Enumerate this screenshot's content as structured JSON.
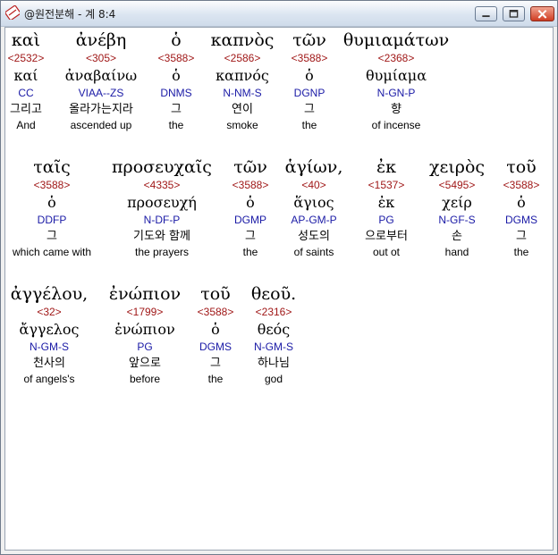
{
  "window": {
    "title": "@원전분해 - 계 8:4",
    "icon": "app-book-icon",
    "buttons": [
      "minimize-icon",
      "maximize-icon",
      "close-icon"
    ],
    "colors": {
      "strong": "#a01818",
      "parse": "#1a1aa6",
      "text": "#000000"
    }
  },
  "verse": {
    "rows": [
      [
        {
          "greek": "καὶ",
          "strong": "<2532>",
          "lemma": "καί",
          "parse": "CC",
          "korean": "그리고",
          "english": "And"
        },
        {
          "greek": "ἀνέβη",
          "strong": "<305>",
          "lemma": "ἀναβαίνω",
          "parse": "VIAA--ZS",
          "korean": "올라가는지라",
          "english": "ascended up"
        },
        {
          "greek": "ὁ",
          "strong": "<3588>",
          "lemma": "ὁ",
          "parse": "DNMS",
          "korean": "그",
          "english": "the"
        },
        {
          "greek": "καπνὸς",
          "strong": "<2586>",
          "lemma": "καπνός",
          "parse": "N-NM-S",
          "korean": "연이",
          "english": "smoke"
        },
        {
          "greek": "τῶν",
          "strong": "<3588>",
          "lemma": "ὁ",
          "parse": "DGNP",
          "korean": "그",
          "english": "the"
        },
        {
          "greek": "θυμιαμάτων",
          "strong": "<2368>",
          "lemma": "θυμίαμα",
          "parse": "N-GN-P",
          "korean": "향",
          "english": "of incense"
        }
      ],
      [
        {
          "greek": "ταῖς",
          "strong": "<3588>",
          "lemma": "ὁ",
          "parse": "DDFP",
          "korean": "그",
          "english": "which came with"
        },
        {
          "greek": "προσευχαῖς",
          "strong": "<4335>",
          "lemma": "προσευχή",
          "parse": "N-DF-P",
          "korean": "기도와 함께",
          "english": "the prayers"
        },
        {
          "greek": "τῶν",
          "strong": "<3588>",
          "lemma": "ὁ",
          "parse": "DGMP",
          "korean": "그",
          "english": "the"
        },
        {
          "greek": "ἁγίων,",
          "strong": "<40>",
          "lemma": "ἅγιος",
          "parse": "AP-GM-P",
          "korean": "성도의",
          "english": "of saints"
        },
        {
          "greek": "ἐκ",
          "strong": "<1537>",
          "lemma": "ἐκ",
          "parse": "PG",
          "korean": "으로부터",
          "english": "out ot"
        },
        {
          "greek": "χειρὸς",
          "strong": "<5495>",
          "lemma": "χείρ",
          "parse": "N-GF-S",
          "korean": "손",
          "english": "hand"
        },
        {
          "greek": "τοῦ",
          "strong": "<3588>",
          "lemma": "ὁ",
          "parse": "DGMS",
          "korean": "그",
          "english": "the"
        }
      ],
      [
        {
          "greek": "ἀγγέλου,",
          "strong": "<32>",
          "lemma": "ἄγγελος",
          "parse": "N-GM-S",
          "korean": "천사의",
          "english": "of angels's"
        },
        {
          "greek": "ἐνώπιον",
          "strong": "<1799>",
          "lemma": "ἐνώπιον",
          "parse": "PG",
          "korean": "앞으로",
          "english": "before"
        },
        {
          "greek": "τοῦ",
          "strong": "<3588>",
          "lemma": "ὁ",
          "parse": "DGMS",
          "korean": "그",
          "english": "the"
        },
        {
          "greek": "θεοῦ.",
          "strong": "<2316>",
          "lemma": "θεός",
          "parse": "N-GM-S",
          "korean": "하나님",
          "english": "god"
        }
      ]
    ]
  }
}
